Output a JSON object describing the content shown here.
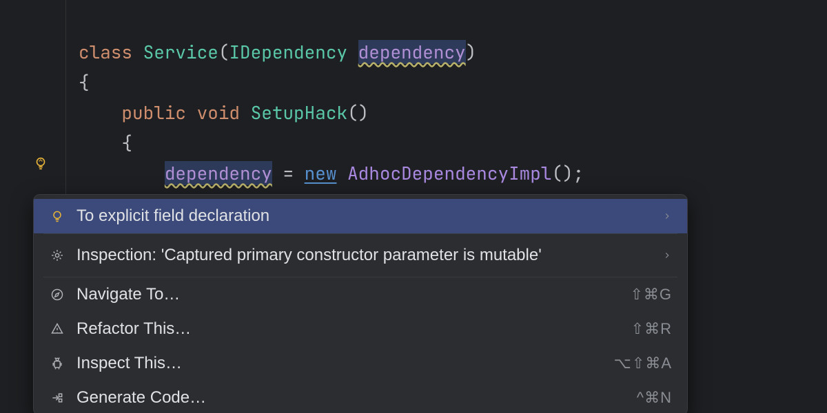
{
  "code": {
    "kw_class": "class",
    "type_service": "Service",
    "type_idep": "IDependency",
    "param_dep": "dependency",
    "kw_public": "public",
    "kw_void": "void",
    "func_setup": "SetupHack",
    "assign_lhs": "dependency",
    "kw_new": "new",
    "type_adhoc": "AdhocDependencyImpl"
  },
  "popup": {
    "items": [
      {
        "icon": "bulb",
        "label": "To explicit field declaration",
        "submenu": true,
        "shortcut": ""
      },
      {
        "icon": "gear",
        "label": "Inspection: 'Captured primary constructor parameter is mutable'",
        "submenu": true,
        "shortcut": ""
      },
      {
        "icon": "compass",
        "label": "Navigate To…",
        "submenu": false,
        "shortcut": "⇧⌘G"
      },
      {
        "icon": "warn",
        "label": "Refactor This…",
        "submenu": false,
        "shortcut": "⇧⌘R"
      },
      {
        "icon": "android",
        "label": "Inspect This…",
        "submenu": false,
        "shortcut": "⌥⇧⌘A"
      },
      {
        "icon": "arrowin",
        "label": "Generate Code…",
        "submenu": false,
        "shortcut": "^⌘N"
      }
    ]
  }
}
